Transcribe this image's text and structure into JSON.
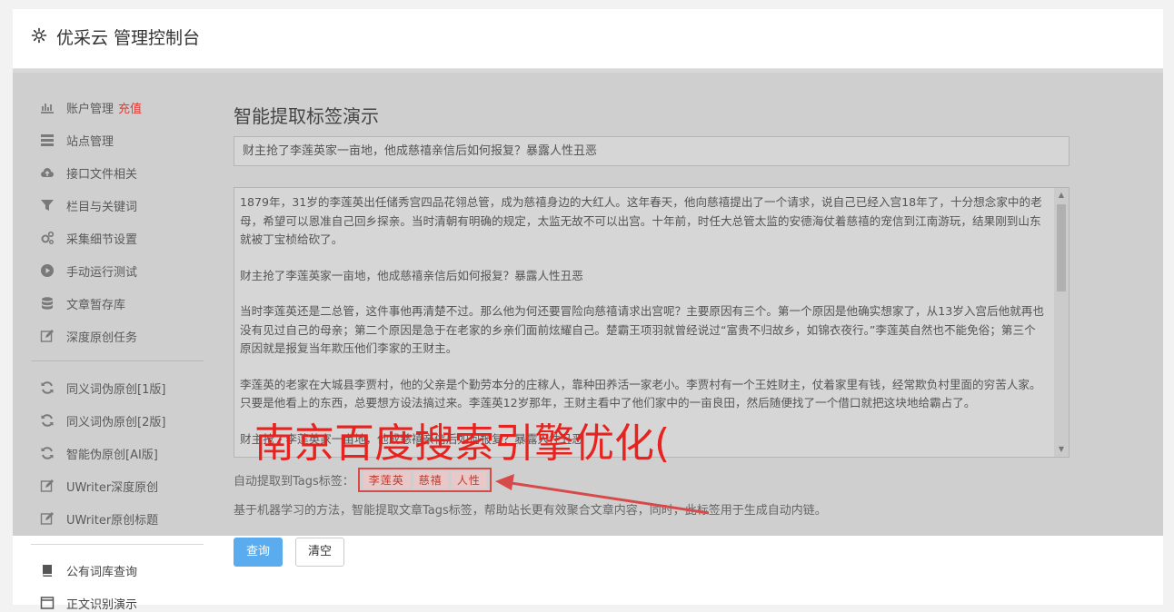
{
  "header": {
    "icon": "gear-icon",
    "title": "优采云 管理控制台"
  },
  "sidebar": {
    "items": [
      {
        "label": "账户管理",
        "badge": "充值",
        "icon": "bar-chart-icon"
      },
      {
        "label": "站点管理",
        "icon": "list-icon"
      },
      {
        "label": "接口文件相关",
        "icon": "cloud-upload-icon"
      },
      {
        "label": "栏目与关键词",
        "icon": "filter-icon"
      },
      {
        "label": "采集细节设置",
        "icon": "gears-icon"
      },
      {
        "label": "手动运行测试",
        "icon": "play-icon"
      },
      {
        "label": "文章暂存库",
        "icon": "database-icon"
      },
      {
        "label": "深度原创任务",
        "icon": "edit-icon"
      },
      {
        "label": "同义词伪原创[1版]",
        "icon": "refresh-icon"
      },
      {
        "label": "同义词伪原创[2版]",
        "icon": "refresh-icon"
      },
      {
        "label": "智能伪原创[AI版]",
        "icon": "refresh-icon"
      },
      {
        "label": "UWriter深度原创",
        "icon": "edit-icon"
      },
      {
        "label": "UWriter原创标题",
        "icon": "edit-icon"
      },
      {
        "label": "公有词库查询",
        "icon": "book-icon"
      },
      {
        "label": "正文识别演示",
        "icon": "window-icon"
      }
    ]
  },
  "main": {
    "title": "智能提取标签演示",
    "title_input_value": "财主抢了李莲英家一亩地，他成慈禧亲信后如何报复？暴露人性丑恶",
    "article_paragraphs": [
      "1879年，31岁的李莲英出任储秀宫四品花翎总管，成为慈禧身边的大红人。这年春天，他向慈禧提出了一个请求，说自己已经入宫18年了，十分想念家中的老母，希望可以恩准自己回乡探亲。当时清朝有明确的规定，太监无故不可以出宫。十年前，时任大总管太监的安德海仗着慈禧的宠信到江南游玩，结果刚到山东就被丁宝桢给砍了。",
      "财主抢了李莲英家一亩地，他成慈禧亲信后如何报复？暴露人性丑恶",
      "当时李莲英还是二总管，这件事他再清楚不过。那么他为何还要冒险向慈禧请求出宫呢？主要原因有三个。第一个原因是他确实想家了，从13岁入宫后他就再也没有见过自己的母亲；第二个原因是急于在老家的乡亲们面前炫耀自己。楚霸王项羽就曾经说过“富贵不归故乡，如锦衣夜行。”李莲英自然也不能免俗；第三个原因就是报复当年欺压他们李家的王财主。",
      "李莲英的老家在大城县李贾村，他的父亲是个勤劳本分的庄稼人，靠种田养活一家老小。李贾村有一个王姓财主，仗着家里有钱，经常欺负村里面的穷苦人家。只要是他看上的东西，总要想方设法搞过来。李莲英12岁那年，王财主看中了他们家中的一亩良田，然后随便找了一个借口就把这块地给霸占了。",
      "财主抢了李莲英家一亩地，他成慈禧亲信后如何报复？暴露人性丑恶"
    ],
    "tags_label": "自动提取到Tags标签：",
    "tags": [
      "李莲英",
      "慈禧",
      "人性"
    ],
    "description": "基于机器学习的方法，智能提取文章Tags标签，帮助站长更有效聚合文章内容，同时，此标签用于生成自动内链。",
    "query_button": "查询",
    "clear_button": "清空"
  },
  "overlay": {
    "text": "南京百度搜索引擎优化(",
    "color": "#e8231f"
  },
  "colors": {
    "accent_button": "#5aacee",
    "recharge": "#e53935",
    "annotation_red": "#d84a4a"
  }
}
